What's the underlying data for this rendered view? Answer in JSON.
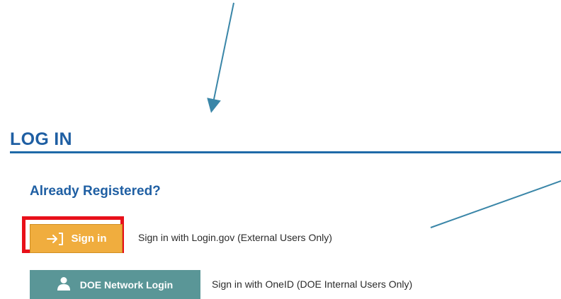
{
  "login": {
    "title": "LOG IN",
    "subtitle": "Already Registered?",
    "sign_in_button": {
      "label": "Sign in",
      "icon": "sign-in-arrow-icon",
      "color": "#f0ad3e"
    },
    "sign_in_description": "Sign in with Login.gov (External Users Only)",
    "doe_button": {
      "label": "DOE Network Login",
      "icon": "user-icon",
      "color": "#5a9697"
    },
    "doe_description": "Sign in with OneID (DOE Internal Users Only)"
  },
  "colors": {
    "heading": "#1f5fa3",
    "highlight": "#e8101a",
    "annotation_arrow": "#3a86a8"
  }
}
